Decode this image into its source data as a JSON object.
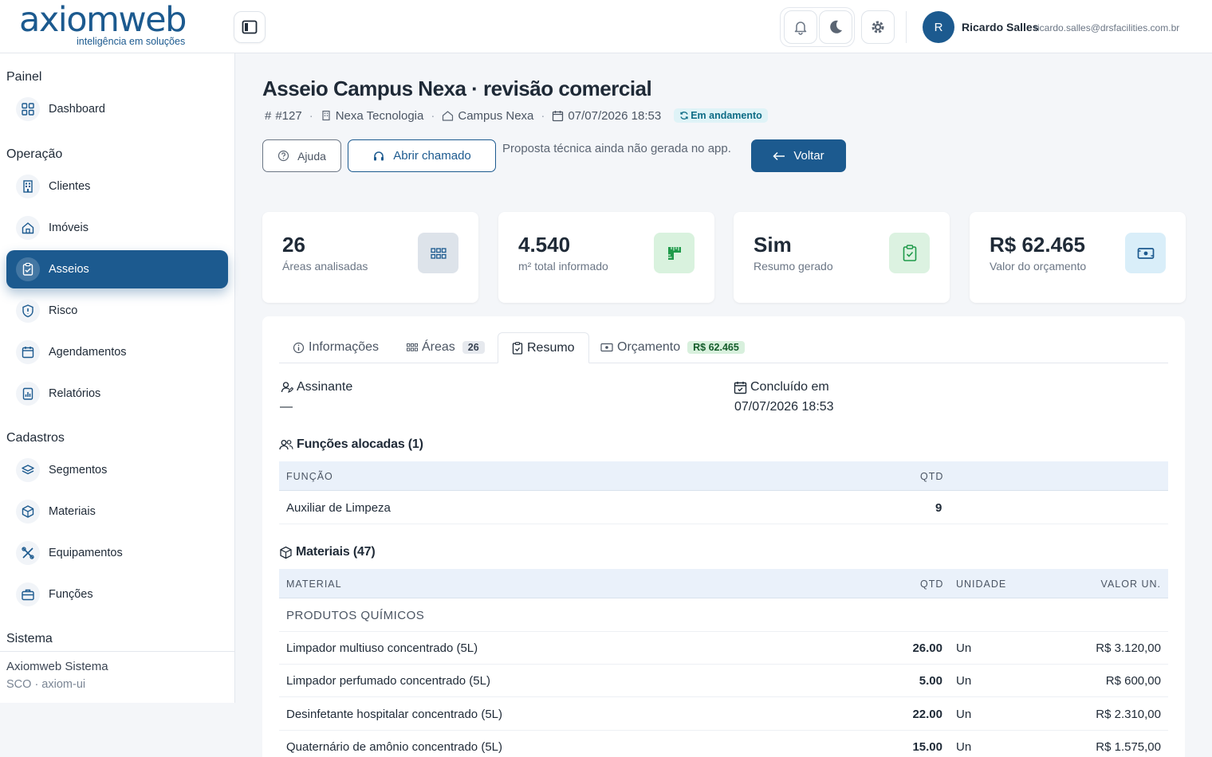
{
  "brand": {
    "name": "axiomweb",
    "tagline": "inteligência em soluções"
  },
  "user": {
    "initial": "R",
    "name": "Ricardo Salles",
    "email": "ricardo.salles@drsfacilities.com.br"
  },
  "sidebar": {
    "sections": [
      {
        "title": "Painel"
      },
      {
        "title": "Operação"
      },
      {
        "title": "Cadastros"
      },
      {
        "title": "Sistema"
      }
    ],
    "items": [
      {
        "label": "Dashboard",
        "icon": "grid-icon"
      },
      {
        "label": "Clientes",
        "icon": "building-icon"
      },
      {
        "label": "Imóveis",
        "icon": "home-icon"
      },
      {
        "label": "Asseios",
        "icon": "clipboard-check-icon",
        "active": true
      },
      {
        "label": "Risco",
        "icon": "shield-icon"
      },
      {
        "label": "Agendamentos",
        "icon": "calendar-icon"
      },
      {
        "label": "Relatórios",
        "icon": "report-icon"
      },
      {
        "label": "Segmentos",
        "icon": "layers-icon"
      },
      {
        "label": "Materiais",
        "icon": "box-icon"
      },
      {
        "label": "Equipamentos",
        "icon": "tools-icon"
      },
      {
        "label": "Funções",
        "icon": "briefcase-icon"
      }
    ],
    "footer": {
      "name": "Axiomweb Sistema",
      "sub": "SCO · axiom-ui"
    }
  },
  "page": {
    "title": "Asseio Campus Nexa · revisão comercial",
    "meta": {
      "id": "#127",
      "client": "Nexa Tecnologia",
      "property": "Campus Nexa",
      "date": "07/07/2026 18:53",
      "status": "Em andamento"
    },
    "actions": {
      "help": "Ajuda",
      "open_ticket": "Abrir chamado",
      "note": "Proposta técnica ainda não gerada no app.",
      "back": "Voltar"
    }
  },
  "stats": [
    {
      "value": "26",
      "label": "Áreas analisadas",
      "icon": "grid-small-icon",
      "color": "#dde3ea"
    },
    {
      "value": "4.540",
      "label": "m² total informado",
      "icon": "ruler-icon",
      "color": "#d9f2de"
    },
    {
      "value": "Sim",
      "label": "Resumo gerado",
      "icon": "clipboard-check-icon",
      "color": "#dcf2e1"
    },
    {
      "value": "R$ 62.465",
      "label": "Valor do orçamento",
      "icon": "cash-icon",
      "color": "#d9eef9"
    }
  ],
  "tabs": [
    {
      "label": "Informações"
    },
    {
      "label": "Áreas",
      "count": "26"
    },
    {
      "label": "Resumo",
      "active": true
    },
    {
      "label": "Orçamento",
      "count": "R$ 62.465"
    }
  ],
  "summary": {
    "signer_label": "Assinante",
    "signer_value": "—",
    "completed_label": "Concluído em",
    "completed_value": "07/07/2026 18:53",
    "roles_title": "Funções alocadas (1)",
    "roles_headers": {
      "role": "FUNÇÃO",
      "qty": "QTD"
    },
    "roles": [
      {
        "role": "Auxiliar de Limpeza",
        "qty": "9"
      }
    ],
    "materials_title": "Materiais (47)",
    "materials_headers": {
      "material": "MATERIAL",
      "qty": "QTD",
      "unit": "UNIDADE",
      "price": "VALOR UN."
    },
    "materials_group": "PRODUTOS QUÍMICOS",
    "materials": [
      {
        "name": "Limpador multiuso concentrado (5L)",
        "qty": "26.00",
        "unit": "Un",
        "price": "R$ 3.120,00"
      },
      {
        "name": "Limpador perfumado concentrado (5L)",
        "qty": "5.00",
        "unit": "Un",
        "price": "R$ 600,00"
      },
      {
        "name": "Desinfetante hospitalar concentrado (5L)",
        "qty": "22.00",
        "unit": "Un",
        "price": "R$ 2.310,00"
      },
      {
        "name": "Quaternário de amônio concentrado (5L)",
        "qty": "15.00",
        "unit": "Un",
        "price": "R$ 1.575,00"
      }
    ]
  },
  "colors": {
    "primary": "#1c5a8f",
    "status_bg": "#dff3f7",
    "status_fg": "#0e6c86"
  }
}
